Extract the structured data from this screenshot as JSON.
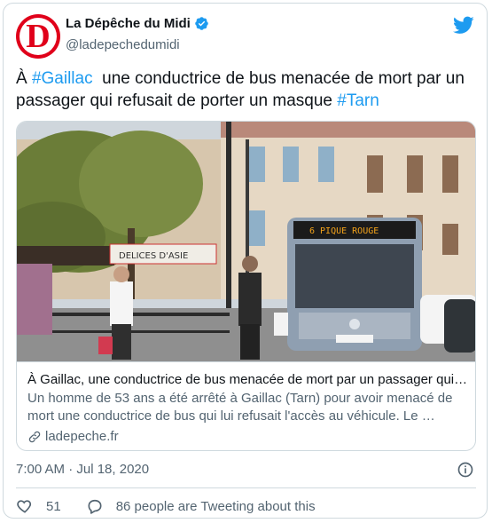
{
  "author": {
    "display_name": "La Dépêche du Midi",
    "handle": "@ladepechedumidi",
    "avatar_letter": "D",
    "verified": true
  },
  "tweet": {
    "prefix": "À ",
    "hashtag1": "#Gaillac",
    "middle": "  une conductrice de bus menacée de mort par un passager qui refusait de porter un masque ",
    "hashtag2": "#Tarn"
  },
  "link_card": {
    "image_alt": "Bus in Gaillac street",
    "bus_sign": "6   PIQUE ROUGE",
    "shop_sign": "DELICES D'ASIE",
    "title": "À Gaillac, une conductrice de bus menacée de mort par un passager qui…",
    "description": "Un homme de 53 ans a été arrêté à Gaillac (Tarn) pour avoir menacé de mort une conductrice de bus qui lui refusait l'accès au véhicule. Le …",
    "domain": "ladepeche.fr"
  },
  "meta": {
    "timestamp": "7:00 AM · Jul 18, 2020"
  },
  "actions": {
    "likes": "51",
    "reply_text": "86 people are Tweeting about this"
  },
  "colors": {
    "accent": "#1d9bf0",
    "brand_red": "#e0001a",
    "muted": "#536471",
    "border": "#cfd9de"
  },
  "icons": [
    "verified-badge-icon",
    "twitter-bird-icon",
    "link-icon",
    "info-icon",
    "heart-icon",
    "speech-bubble-icon"
  ]
}
